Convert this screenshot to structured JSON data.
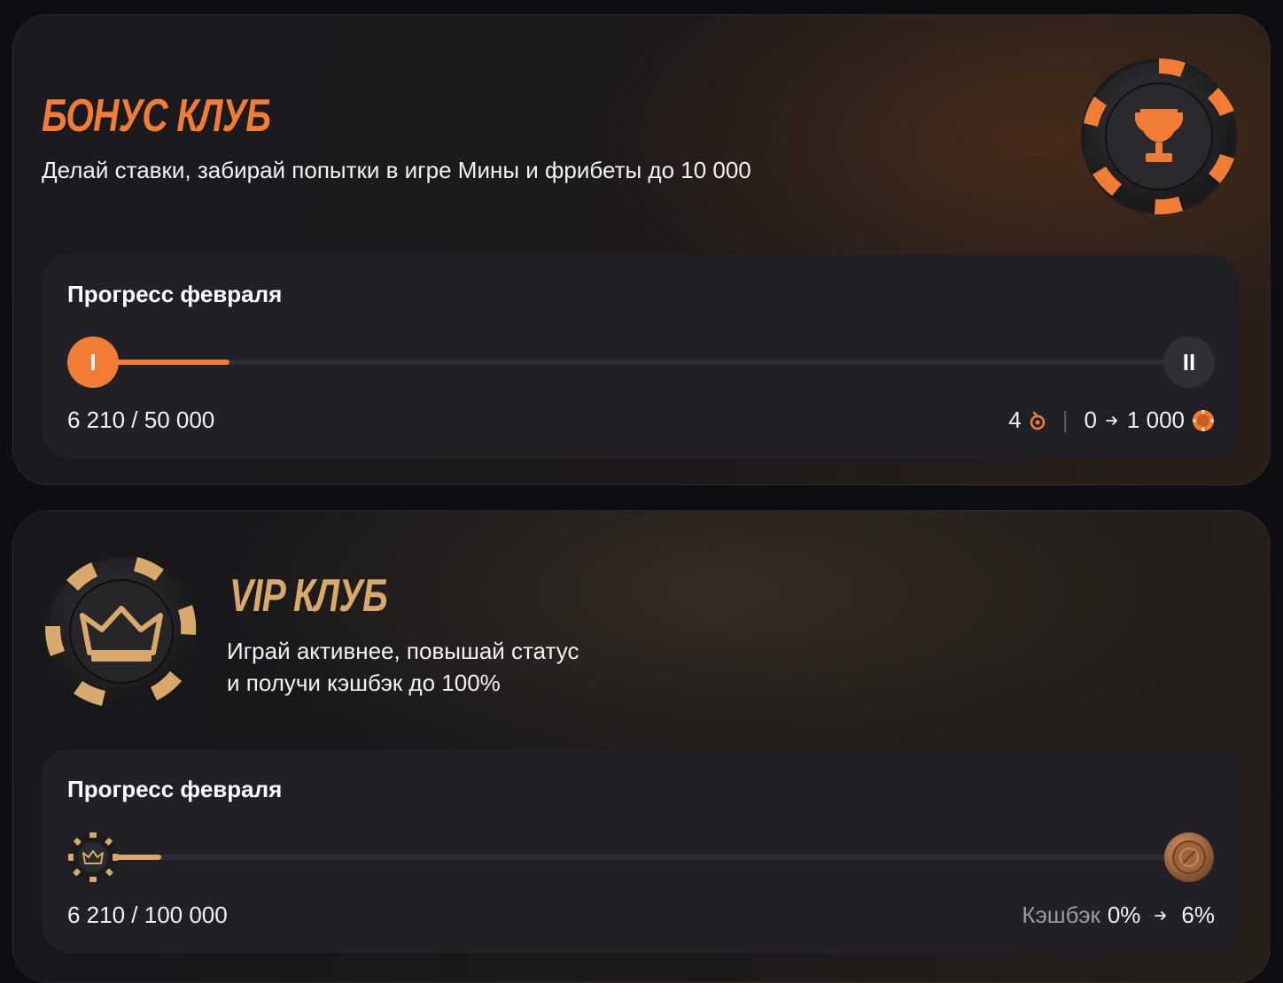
{
  "bonus_club": {
    "title": "БОНУС КЛУБ",
    "subtitle": "Делай ставки, забирай попытки в игре Мины и фрибеты до 10 000",
    "progress": {
      "title": "Прогресс февраля",
      "value_text": "6 210 / 50 000",
      "current": 6210,
      "target": 50000,
      "start_level": "I",
      "end_level": "II",
      "reward_attempts": "4",
      "reward_from": "0",
      "reward_to": "1 000",
      "attempts_icon": "mines-attempt-icon",
      "coin_icon": "freebet-coin-icon"
    }
  },
  "vip_club": {
    "title": "VIP КЛУБ",
    "subtitle_line1": "Играй активнее, повышай статус",
    "subtitle_line2": "и получи кэшбэк до 100%",
    "progress": {
      "title": "Прогресс февраля",
      "value_text": "6 210 / 100 000",
      "current": 6210,
      "target": 100000,
      "cashback_label": "Кэшбэк",
      "cashback_from": "0%",
      "cashback_to": "6%",
      "start_icon": "crown-chip-icon",
      "end_icon": "bronze-chip-icon"
    }
  },
  "colors": {
    "bonus_accent": "#f07c36",
    "vip_accent": "#d9a86b"
  }
}
